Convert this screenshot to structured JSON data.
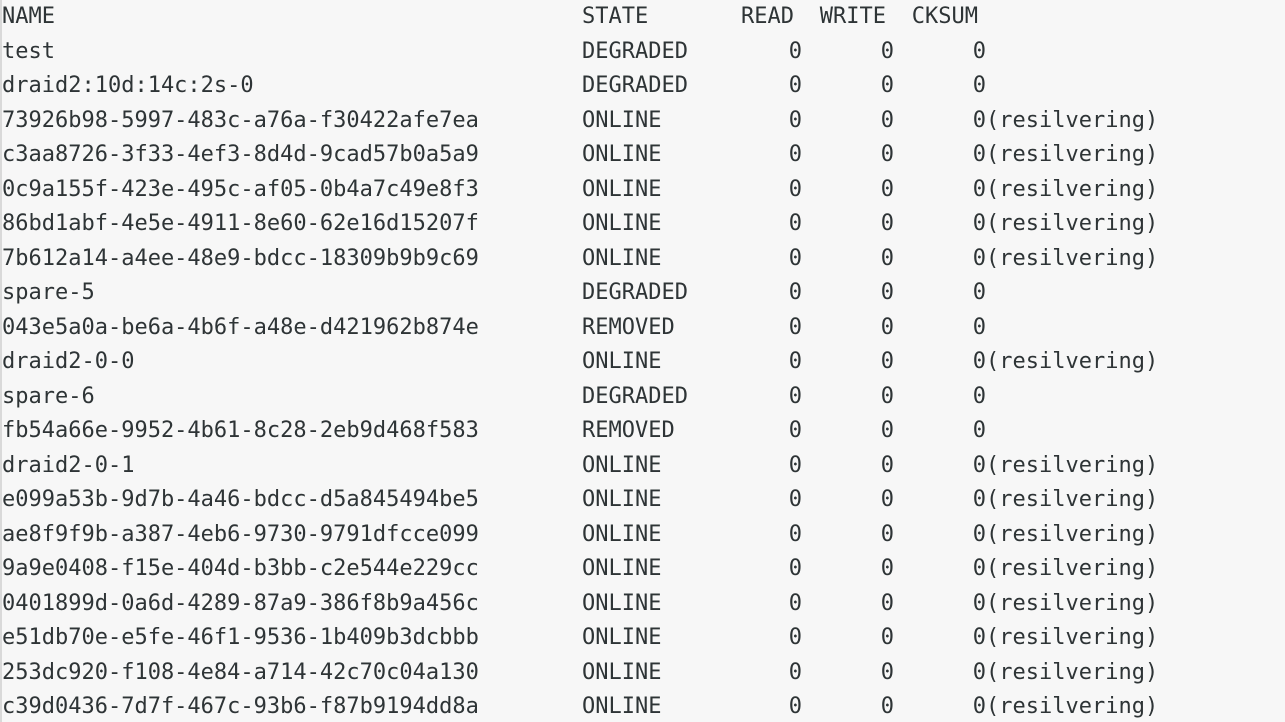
{
  "terminal": {
    "background_color": "#f7f7f7",
    "text_color": "#2e3436",
    "border_color": "#d9d9d9"
  },
  "table": {
    "headers": {
      "name": "NAME",
      "state": "STATE",
      "read": "READ",
      "write": "WRITE",
      "cksum": "CKSUM",
      "note": ""
    },
    "rows": [
      {
        "indent": 0,
        "name": "test",
        "state": "DEGRADED",
        "read": "0",
        "write": "0",
        "cksum": "0",
        "note": ""
      },
      {
        "indent": 2,
        "name": "draid2:10d:14c:2s-0",
        "state": "DEGRADED",
        "read": "0",
        "write": "0",
        "cksum": "0",
        "note": ""
      },
      {
        "indent": 4,
        "name": "73926b98-5997-483c-a76a-f30422afe7ea",
        "state": "ONLINE",
        "read": "0",
        "write": "0",
        "cksum": "0",
        "note": "(resilvering)"
      },
      {
        "indent": 4,
        "name": "c3aa8726-3f33-4ef3-8d4d-9cad57b0a5a9",
        "state": "ONLINE",
        "read": "0",
        "write": "0",
        "cksum": "0",
        "note": "(resilvering)"
      },
      {
        "indent": 4,
        "name": "0c9a155f-423e-495c-af05-0b4a7c49e8f3",
        "state": "ONLINE",
        "read": "0",
        "write": "0",
        "cksum": "0",
        "note": "(resilvering)"
      },
      {
        "indent": 4,
        "name": "86bd1abf-4e5e-4911-8e60-62e16d15207f",
        "state": "ONLINE",
        "read": "0",
        "write": "0",
        "cksum": "0",
        "note": "(resilvering)"
      },
      {
        "indent": 4,
        "name": "7b612a14-a4ee-48e9-bdcc-18309b9b9c69",
        "state": "ONLINE",
        "read": "0",
        "write": "0",
        "cksum": "0",
        "note": "(resilvering)"
      },
      {
        "indent": 4,
        "name": "spare-5",
        "state": "DEGRADED",
        "read": "0",
        "write": "0",
        "cksum": "0",
        "note": ""
      },
      {
        "indent": 6,
        "name": "043e5a0a-be6a-4b6f-a48e-d421962b874e",
        "state": "REMOVED",
        "read": "0",
        "write": "0",
        "cksum": "0",
        "note": ""
      },
      {
        "indent": 6,
        "name": "draid2-0-0",
        "state": "ONLINE",
        "read": "0",
        "write": "0",
        "cksum": "0",
        "note": "(resilvering)"
      },
      {
        "indent": 4,
        "name": "spare-6",
        "state": "DEGRADED",
        "read": "0",
        "write": "0",
        "cksum": "0",
        "note": ""
      },
      {
        "indent": 6,
        "name": "fb54a66e-9952-4b61-8c28-2eb9d468f583",
        "state": "REMOVED",
        "read": "0",
        "write": "0",
        "cksum": "0",
        "note": ""
      },
      {
        "indent": 6,
        "name": "draid2-0-1",
        "state": "ONLINE",
        "read": "0",
        "write": "0",
        "cksum": "0",
        "note": "(resilvering)"
      },
      {
        "indent": 4,
        "name": "e099a53b-9d7b-4a46-bdcc-d5a845494be5",
        "state": "ONLINE",
        "read": "0",
        "write": "0",
        "cksum": "0",
        "note": "(resilvering)"
      },
      {
        "indent": 4,
        "name": "ae8f9f9b-a387-4eb6-9730-9791dfcce099",
        "state": "ONLINE",
        "read": "0",
        "write": "0",
        "cksum": "0",
        "note": "(resilvering)"
      },
      {
        "indent": 4,
        "name": "9a9e0408-f15e-404d-b3bb-c2e544e229cc",
        "state": "ONLINE",
        "read": "0",
        "write": "0",
        "cksum": "0",
        "note": "(resilvering)"
      },
      {
        "indent": 4,
        "name": "0401899d-0a6d-4289-87a9-386f8b9a456c",
        "state": "ONLINE",
        "read": "0",
        "write": "0",
        "cksum": "0",
        "note": "(resilvering)"
      },
      {
        "indent": 4,
        "name": "e51db70e-e5fe-46f1-9536-1b409b3dcbbb",
        "state": "ONLINE",
        "read": "0",
        "write": "0",
        "cksum": "0",
        "note": "(resilvering)"
      },
      {
        "indent": 4,
        "name": "253dc920-f108-4e84-a714-42c70c04a130",
        "state": "ONLINE",
        "read": "0",
        "write": "0",
        "cksum": "0",
        "note": "(resilvering)"
      },
      {
        "indent": 4,
        "name": "c39d0436-7d7f-467c-93b6-f87b9194dd8a",
        "state": "ONLINE",
        "read": "0",
        "write": "0",
        "cksum": "0",
        "note": "(resilvering)"
      }
    ]
  }
}
